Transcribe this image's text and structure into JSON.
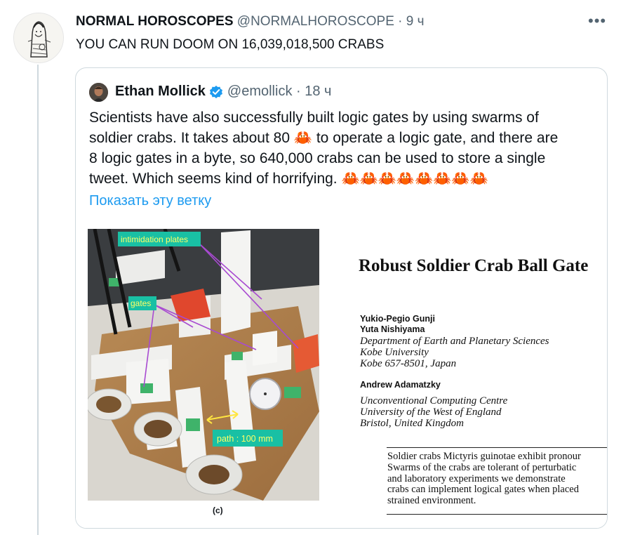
{
  "tweet": {
    "author_name": "NORMAL HOROSCOPES",
    "handle_time": "@NORMALHOROSCOPE · 9 ч",
    "more_icon": "•••",
    "text": "YOU CAN RUN DOOM ON 16,039,018,500 CRABS"
  },
  "quote": {
    "author_name": "Ethan Mollick",
    "handle_time": "@emollick · 18 ч",
    "text_line1": "Scientists have also successfully built logic gates by using swarms of",
    "text_line2a": "soldier crabs. It takes about 80",
    "crab_emoji": "🦀",
    "text_line2b": "to operate a logic gate, and there are",
    "text_line3": "8 logic gates in a byte, so 640,000 crabs can be used to store a single",
    "text_line4": "tweet. Which seems kind of horrifying.",
    "crab_row": "🦀🦀🦀🦀🦀🦀🦀🦀",
    "show_thread": "Показать эту ветку",
    "colors": {
      "link": "#1d9bf0",
      "verified": "#1d9bf0"
    }
  },
  "media": {
    "labels": {
      "intimidation": "intimidation plates",
      "gates": "gates",
      "path": "path : 100 mm"
    },
    "caption": "(c)",
    "paper": {
      "title": "Robust Soldier Crab Ball Gate",
      "author1": "Yukio-Pegio Gunji",
      "author2": "Yuta Nishiyama",
      "aff1": [
        "Department of Earth and Planetary Sciences",
        "Kobe University",
        "Kobe 657-8501, Japan"
      ],
      "author3": "Andrew Adamatzky",
      "aff2": [
        "Unconventional Computing Centre",
        "University of the West of England",
        "Bristol, United Kingdom"
      ],
      "abstract": [
        "Soldier crabs Mictyris guinotae exhibit pronour",
        "Swarms of the crabs are tolerant of perturbatic",
        "and laboratory experiments we demonstrate",
        "crabs can implement logical gates when placed",
        "strained environment."
      ]
    }
  }
}
